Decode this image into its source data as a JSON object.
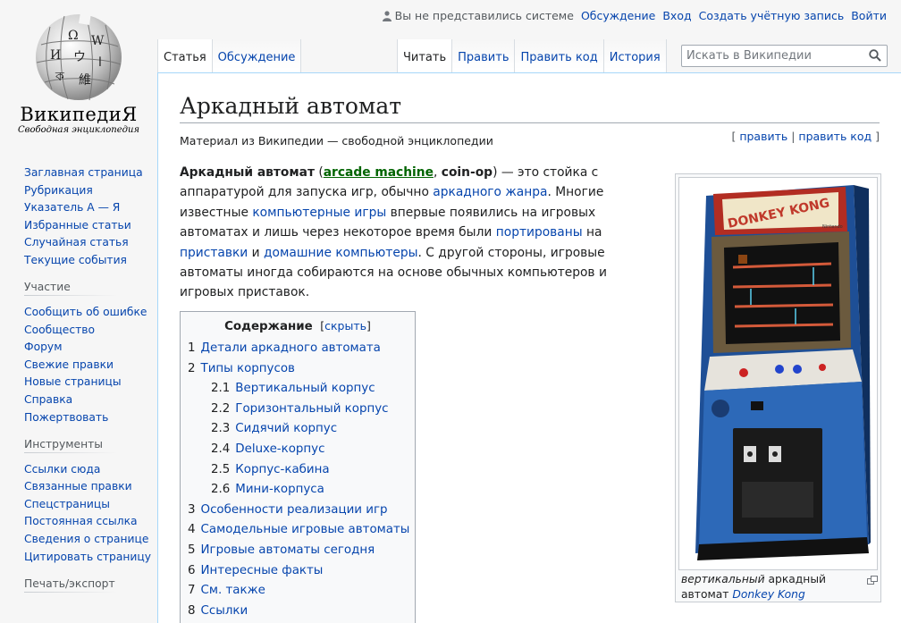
{
  "personal": {
    "anon": "Вы не представились системе",
    "discussion": "Обсуждение",
    "login": "Вход",
    "create": "Создать учётную запись",
    "logout": "Войти"
  },
  "logo": {
    "wordmark": "ВикипедиЯ",
    "tagline": "Свободная энциклопедия"
  },
  "tabs": {
    "article": "Статья",
    "talk": "Обсуждение",
    "read": "Читать",
    "edit": "Править",
    "edit_source": "Править код",
    "history": "История"
  },
  "search": {
    "placeholder": "Искать в Википедии"
  },
  "sidebar": {
    "nav": [
      "Заглавная страница",
      "Рубрикация",
      "Указатель А — Я",
      "Избранные статьи",
      "Случайная статья",
      "Текущие события"
    ],
    "participation_title": "Участие",
    "participation": [
      "Сообщить об ошибке",
      "Сообщество",
      "Форум",
      "Свежие правки",
      "Новые страницы",
      "Справка",
      "Пожертвовать"
    ],
    "tools_title": "Инструменты",
    "tools": [
      "Ссылки сюда",
      "Связанные правки",
      "Спецстраницы",
      "Постоянная ссылка",
      "Сведения о странице",
      "Цитировать страницу"
    ],
    "export_title": "Печать/экспорт"
  },
  "article": {
    "title": "Аркадный автомат",
    "subtitle": "Материал из Википедии — свободной энциклопедии",
    "edit_open": "[ ",
    "edit": "править",
    "edit_sep": " | ",
    "edit_source": "править код",
    "edit_close": " ]",
    "intro": {
      "t1": "Аркадный автомат",
      "t2": " (",
      "l1": "arcade machine",
      "t3": ", ",
      "t4": "coin-op",
      "t5": ") — это стойка с аппаратурой для запуска игр, обычно ",
      "l2": "аркадного жанра",
      "t6": ". Многие известные ",
      "l3": "компьютерные игры",
      "t7": " впервые появились на игровых автоматах и лишь через некоторое время были ",
      "l4": "портированы",
      "t8": " на ",
      "l5": "приставки",
      "t9": " и ",
      "l6": "домашние компьютеры",
      "t10": ". С другой стороны, игровые автоматы иногда собираются на основе обычных компьютеров и игровых приставок."
    }
  },
  "toc": {
    "title": "Содержание",
    "hide": "скрыть",
    "hide_open": "[",
    "hide_close": "]",
    "items": [
      {
        "num": "1",
        "label": "Детали аркадного автомата"
      },
      {
        "num": "2",
        "label": "Типы корпусов"
      },
      {
        "num": "2.1",
        "label": "Вертикальный корпус"
      },
      {
        "num": "2.2",
        "label": "Горизонтальный корпус"
      },
      {
        "num": "2.3",
        "label": "Сидячий корпус"
      },
      {
        "num": "2.4",
        "label": "Deluxe-корпус"
      },
      {
        "num": "2.5",
        "label": "Корпус-кабина"
      },
      {
        "num": "2.6",
        "label": "Мини-корпуса"
      },
      {
        "num": "3",
        "label": "Особенности реализации игр"
      },
      {
        "num": "4",
        "label": "Самодельные игровые автоматы"
      },
      {
        "num": "5",
        "label": "Игровые автоматы сегодня"
      },
      {
        "num": "6",
        "label": "Интересные факты"
      },
      {
        "num": "7",
        "label": "См. также"
      },
      {
        "num": "8",
        "label": "Ссылки"
      }
    ]
  },
  "thumb": {
    "cap1": "вертикальный",
    "cap2": " аркадный автомат ",
    "cap3": "Donkey Kong",
    "marquee": "DONKEY KONG",
    "brand": "Nintendo"
  },
  "colors": {
    "link": "#0645ad",
    "cabinet_blue": "#2d69b8",
    "marquee_red": "#c0392b"
  }
}
